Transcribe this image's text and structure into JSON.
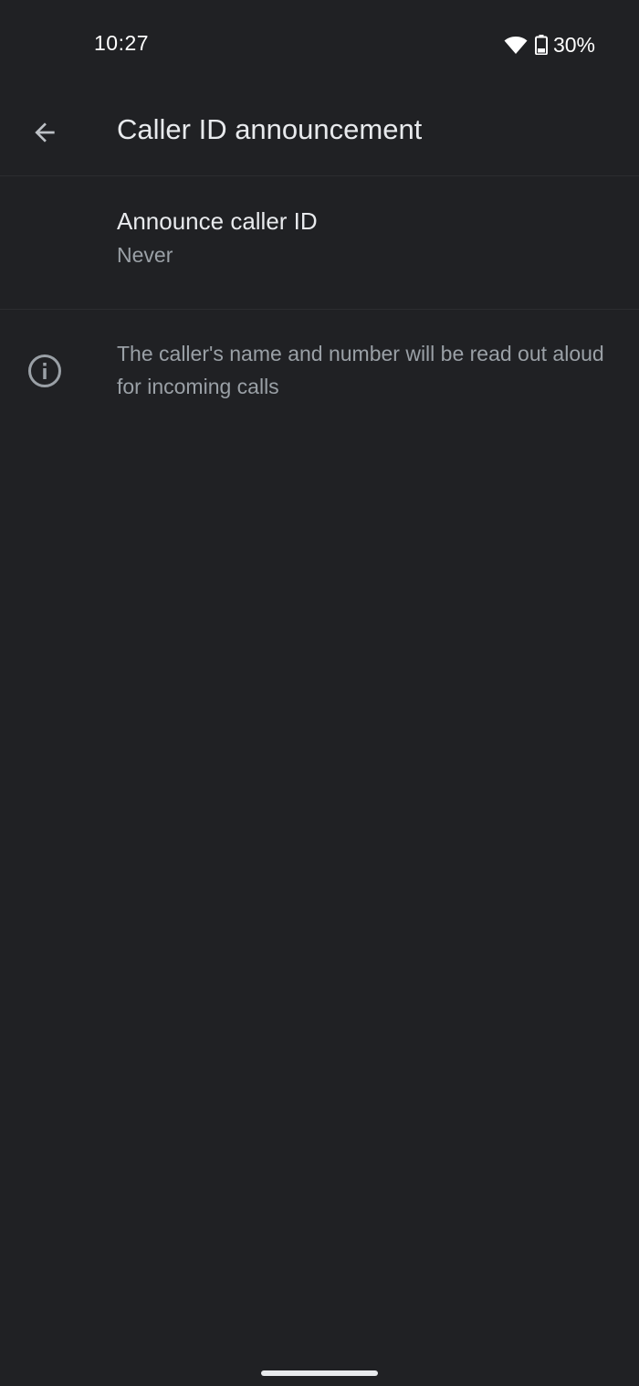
{
  "status_bar": {
    "time": "10:27",
    "battery_percent": "30%",
    "icons": [
      "wifi-icon",
      "battery-icon"
    ]
  },
  "app_bar": {
    "back_icon": "arrow-back-icon",
    "title": "Caller ID announcement"
  },
  "setting": {
    "title": "Announce caller ID",
    "summary": "Never"
  },
  "info": {
    "icon": "info-icon",
    "text": "The caller's name and number will be read out aloud for incoming calls"
  },
  "colors": {
    "background": "#202124",
    "primary_text": "#e8eaed",
    "secondary_text": "#9aa0a6",
    "divider": "#2c2d30"
  }
}
